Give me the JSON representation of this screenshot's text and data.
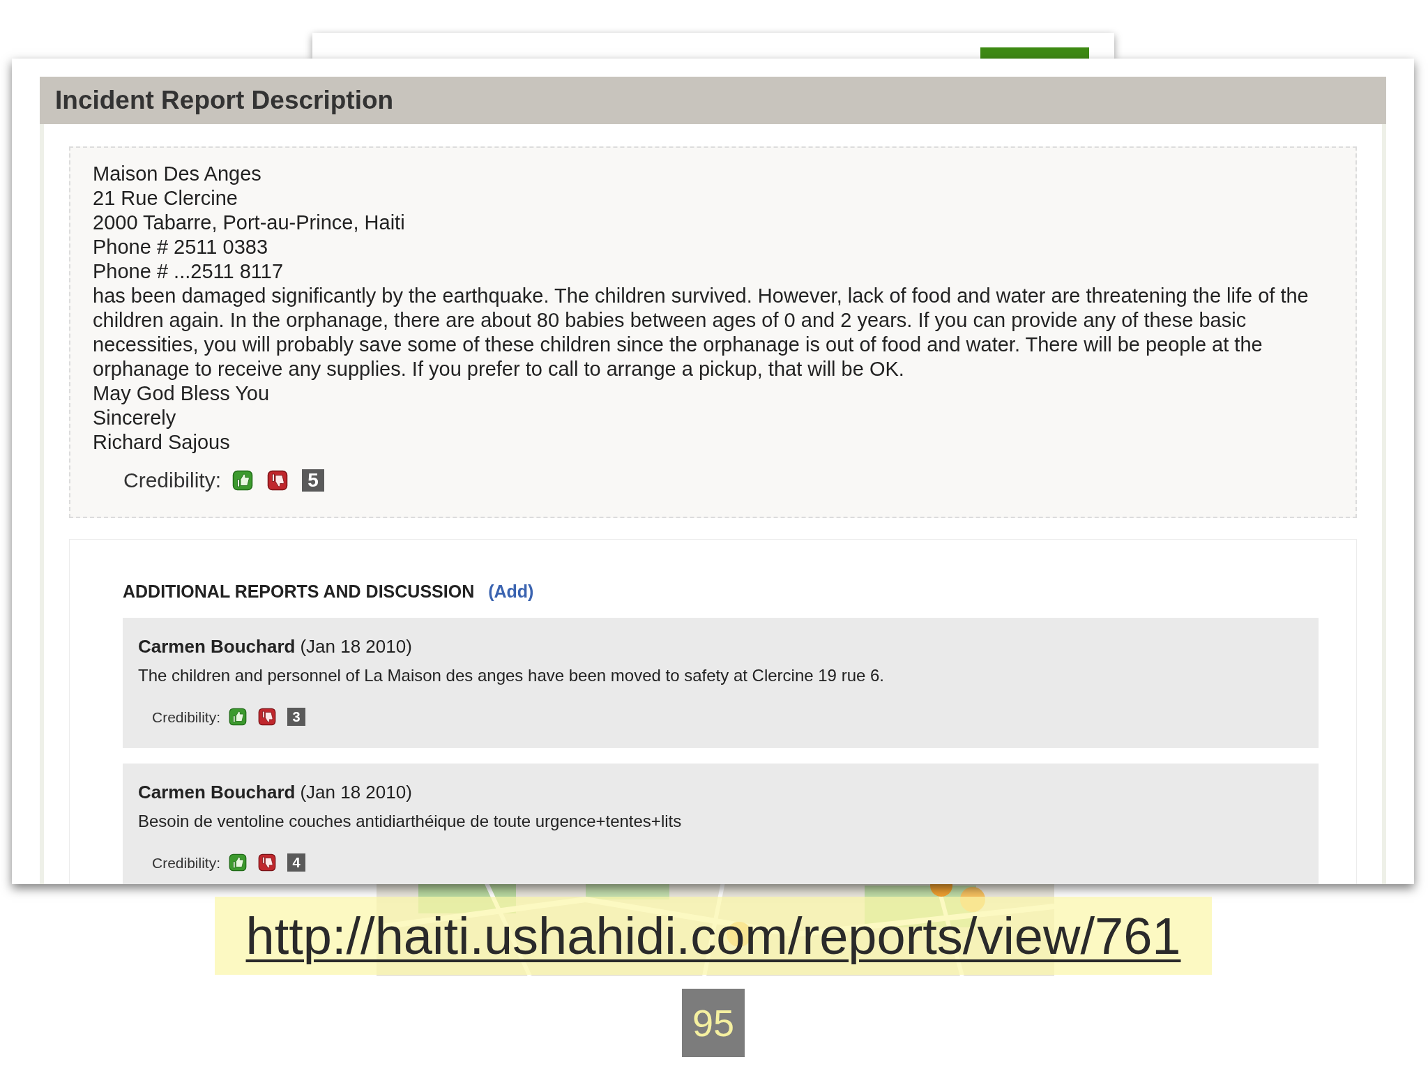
{
  "report": {
    "title": "Incident Report Description",
    "lines": [
      "Maison Des Anges",
      "21 Rue Clercine",
      "2000 Tabarre, Port-au-Prince, Haiti",
      "Phone # 2511 0383",
      "Phone # ...2511 8117",
      "has been damaged significantly by the earthquake. The children survived. However, lack of food and water are threatening the life of the children again. In the orphanage, there are about 80 babies between ages of 0 and 2 years. If you can provide any of these basic necessities, you will probably save some of these children since the orphanage is out of food and water. There will be people at the orphanage to receive any supplies. If you prefer to call to arrange a pickup, that will be OK.",
      "May God Bless You",
      "Sincerely",
      "Richard Sajous"
    ],
    "credibility_label": "Credibility:",
    "credibility": "5"
  },
  "discussion": {
    "heading": "ADDITIONAL REPORTS AND DISCUSSION",
    "add_link": "(Add)",
    "comments": [
      {
        "author": "Carmen Bouchard",
        "date": "(Jan 18 2010)",
        "text": "The children and personnel of La Maison des anges have been moved to safety at Clercine 19 rue 6.",
        "credibility_label": "Credibility:",
        "credibility": "3"
      },
      {
        "author": "Carmen Bouchard",
        "date": "(Jan 18 2010)",
        "text": "Besoin de ventoline couches antidiarthéique de toute urgence+tentes+lits",
        "credibility_label": "Credibility:",
        "credibility": "4"
      }
    ]
  },
  "url": "http://haiti.ushahidi.com/reports/view/761",
  "page_number": "95"
}
